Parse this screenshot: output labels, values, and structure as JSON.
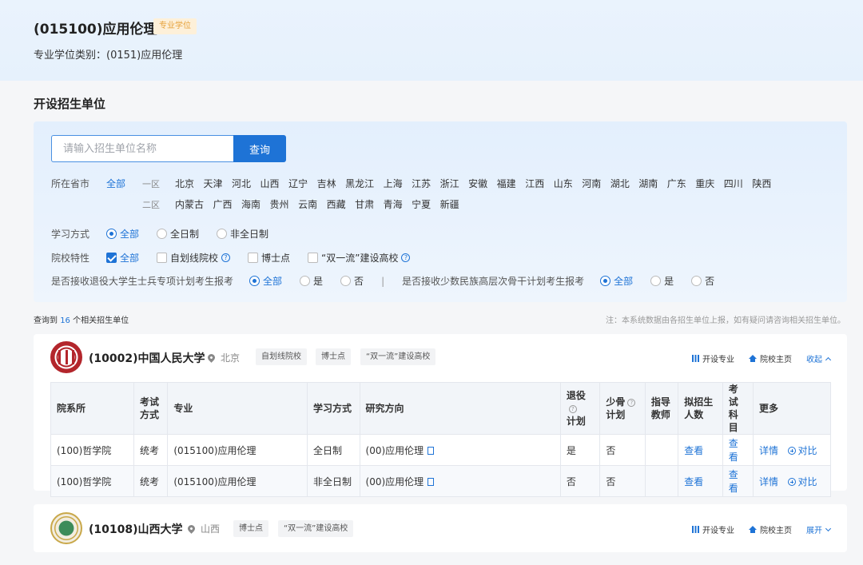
{
  "header": {
    "title": "(015100)应用伦理",
    "badge": "专业学位",
    "subtitle": "专业学位类别：(0151)应用伦理"
  },
  "section_title": "开设招生单位",
  "search": {
    "placeholder": "请输入招生单位名称",
    "button": "查询"
  },
  "filters": {
    "province_label": "所在省市",
    "province_all": "全部",
    "zone1_label": "一区",
    "zone1": [
      "北京",
      "天津",
      "河北",
      "山西",
      "辽宁",
      "吉林",
      "黑龙江",
      "上海",
      "江苏",
      "浙江",
      "安徽",
      "福建",
      "江西",
      "山东",
      "河南",
      "湖北",
      "湖南",
      "广东",
      "重庆",
      "四川",
      "陕西"
    ],
    "zone2_label": "二区",
    "zone2": [
      "内蒙古",
      "广西",
      "海南",
      "贵州",
      "云南",
      "西藏",
      "甘肃",
      "青海",
      "宁夏",
      "新疆"
    ],
    "study_label": "学习方式",
    "study_options": [
      "全部",
      "全日制",
      "非全日制"
    ],
    "school_label": "院校特性",
    "school_options": [
      "全部",
      "自划线院校",
      "博士点",
      "“双一流”建设高校"
    ],
    "veteran_label": "是否接收退役大学生士兵专项计划考生报考",
    "veteran_options": [
      "全部",
      "是",
      "否"
    ],
    "divider": "|",
    "minority_label": "是否接收少数民族高层次骨干计划考生报考",
    "minority_options": [
      "全部",
      "是",
      "否"
    ],
    "help_glyph": "?"
  },
  "results": {
    "prefix": "查询到",
    "count": "16",
    "suffix": "个相关招生单位",
    "note": "注：本系统数据由各招生单位上报，如有疑问请咨询相关招生单位。"
  },
  "card_actions": {
    "majors": "开设专业",
    "home": "院校主页",
    "collapse": "收起",
    "expand": "展开"
  },
  "universities": [
    {
      "name": "(10002)中国人民大学",
      "location": "北京",
      "tags": [
        "自划线院校",
        "博士点",
        "“双一流”建设高校"
      ]
    },
    {
      "name": "(10108)山西大学",
      "location": "山西",
      "tags": [
        "博士点",
        "“双一流”建设高校"
      ]
    }
  ],
  "table": {
    "headers": {
      "dept": "院系所",
      "exam_mode_1": "考试",
      "exam_mode_2": "方式",
      "major": "专业",
      "study_mode": "学习方式",
      "direction": "研究方向",
      "veteran_1": "退役",
      "veteran_2": "计划",
      "minority_1": "少骨",
      "minority_2": "计划",
      "advisor_1": "指导",
      "advisor_2": "教师",
      "enroll_1": "拟招生",
      "enroll_2": "人数",
      "subjects_1": "考试",
      "subjects_2": "科目",
      "more": "更多"
    },
    "rows": [
      {
        "dept": "(100)哲学院",
        "exam_mode": "统考",
        "major": "(015100)应用伦理",
        "study_mode": "全日制",
        "direction": "(00)应用伦理",
        "veteran": "是",
        "minority": "否",
        "advisor": "",
        "enroll": "查看",
        "subjects": "查看",
        "detail": "详情",
        "compare": "对比"
      },
      {
        "dept": "(100)哲学院",
        "exam_mode": "统考",
        "major": "(015100)应用伦理",
        "study_mode": "非全日制",
        "direction": "(00)应用伦理",
        "veteran": "否",
        "minority": "否",
        "advisor": "",
        "enroll": "查看",
        "subjects": "查看",
        "detail": "详情",
        "compare": "对比"
      }
    ]
  },
  "colors": {
    "accent": "#1e73d6",
    "badge_bg": "#fdf0d9",
    "badge_text": "#e6a23c",
    "header_bg": "#eaf3fd"
  }
}
